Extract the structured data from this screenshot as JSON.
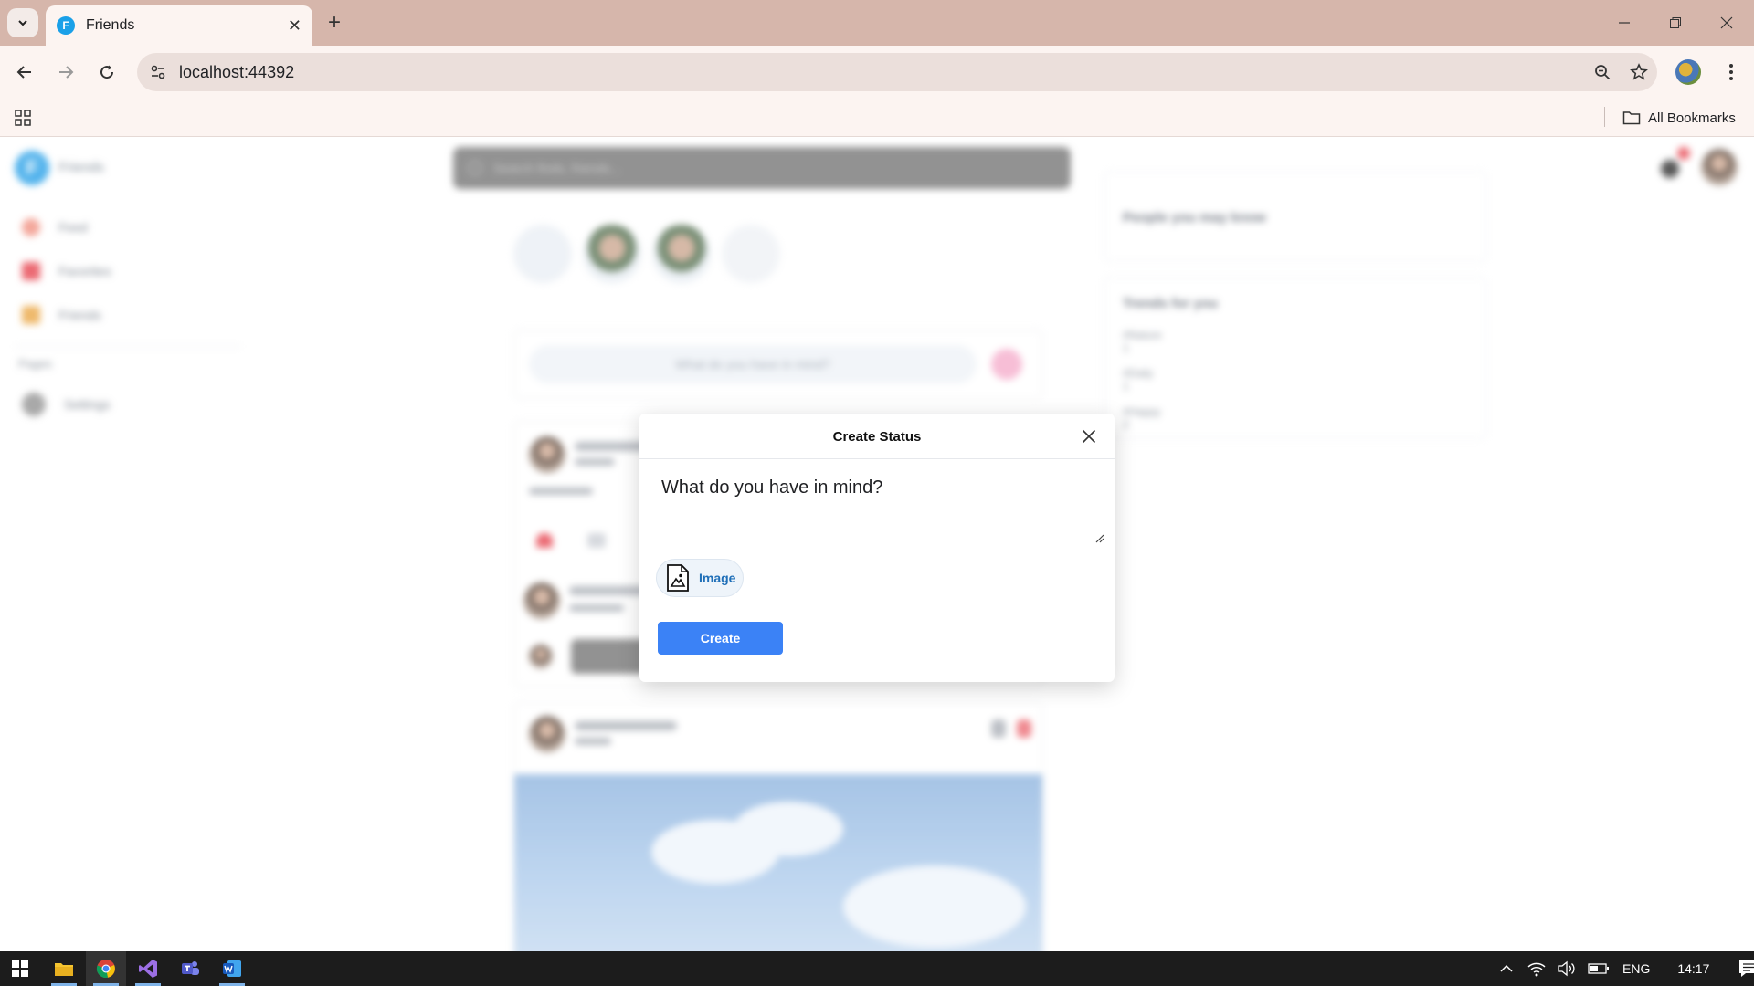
{
  "browser": {
    "tab_title": "Friends",
    "tab_favicon_letter": "F",
    "url": "localhost:44392",
    "bookmarks_label": "All Bookmarks"
  },
  "app": {
    "logo_letter": "F",
    "name": "Friends",
    "search_placeholder": "Search finds, friends...",
    "sidebar": [
      {
        "label": "Feed",
        "color": "#f08a7a"
      },
      {
        "label": "Favorites",
        "color": "#e53945"
      },
      {
        "label": "Friends",
        "color": "#e9a23b"
      }
    ],
    "sidebar_section": "Pages",
    "sidebar_settings": "Settings",
    "composer_placeholder": "What do you have in mind?",
    "right_cards": {
      "people_title": "People you may know",
      "trends_title": "Trends for you",
      "trends": [
        {
          "name": "#Nature",
          "count": "1"
        },
        {
          "name": "#Daily",
          "count": "1"
        },
        {
          "name": "#Happy",
          "count": "2"
        }
      ]
    }
  },
  "modal": {
    "title": "Create Status",
    "textarea_placeholder": "What do you have in mind?",
    "image_button_label": "Image",
    "create_button_label": "Create"
  },
  "taskbar": {
    "language": "ENG",
    "time": "14:17"
  },
  "colors": {
    "primary_button": "#3b82f6",
    "tab_bar": "#d6b6ab",
    "chrome_bg": "#fcf4f1"
  }
}
